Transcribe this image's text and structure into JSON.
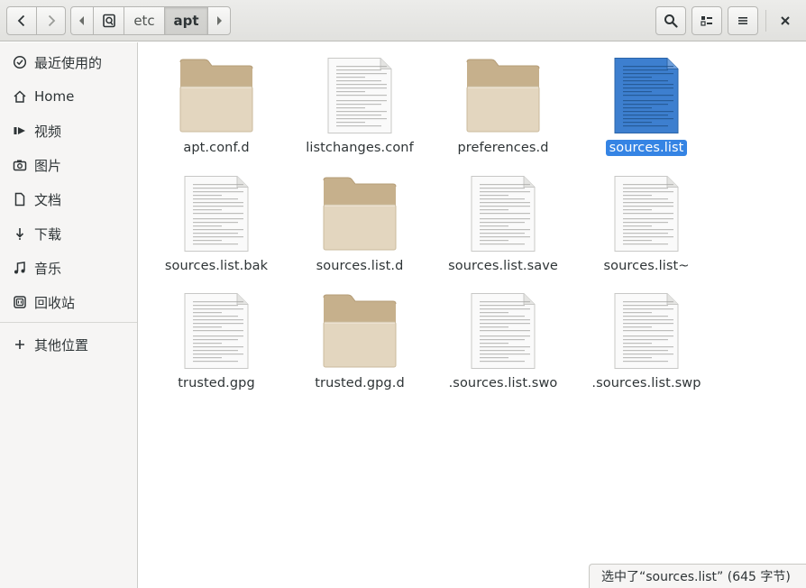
{
  "header": {
    "back_icon": "go-previous-icon",
    "forward_icon": "go-next-icon",
    "breadcrumb": {
      "scroll_left_icon": "pan-start-icon",
      "root_icon": "drive-harddisk-icon",
      "segments": [
        "etc",
        "apt"
      ],
      "current": "apt",
      "scroll_right_icon": "pan-end-icon"
    },
    "search_icon": "search-icon",
    "view_icon": "view-list-icon",
    "menu_icon": "hamburger-menu-icon",
    "close_icon": "close-icon"
  },
  "sidebar": {
    "items": [
      {
        "label": "最近使用的",
        "icon": "clock-icon"
      },
      {
        "label": "Home",
        "icon": "home-icon"
      },
      {
        "label": "视频",
        "icon": "video-icon"
      },
      {
        "label": "图片",
        "icon": "camera-icon"
      },
      {
        "label": "文档",
        "icon": "document-icon"
      },
      {
        "label": "下载",
        "icon": "download-icon"
      },
      {
        "label": "音乐",
        "icon": "music-icon"
      },
      {
        "label": "回收站",
        "icon": "trash-icon"
      }
    ],
    "other_locations": {
      "label": "其他位置",
      "icon": "plus-icon"
    }
  },
  "files": [
    {
      "name": "apt.conf.d",
      "type": "folder",
      "selected": false
    },
    {
      "name": "listchanges.conf",
      "type": "text",
      "selected": false
    },
    {
      "name": "preferences.d",
      "type": "folder",
      "selected": false
    },
    {
      "name": "sources.list",
      "type": "text",
      "selected": true
    },
    {
      "name": "sources.list.bak",
      "type": "text",
      "selected": false
    },
    {
      "name": "sources.list.d",
      "type": "folder",
      "selected": false
    },
    {
      "name": "sources.list.save",
      "type": "text",
      "selected": false
    },
    {
      "name": "sources.list~",
      "type": "text",
      "selected": false
    },
    {
      "name": "trusted.gpg",
      "type": "text",
      "selected": false
    },
    {
      "name": "trusted.gpg.d",
      "type": "folder",
      "selected": false
    },
    {
      "name": ".sources.list.swo",
      "type": "text",
      "selected": false
    },
    {
      "name": ".sources.list.swp",
      "type": "text",
      "selected": false
    }
  ],
  "status": {
    "text": "选中了“sources.list” (645 字节)"
  },
  "colors": {
    "selection": "#3584e4",
    "folder": "#e3d6bf",
    "folder_tab": "#c6b08c"
  }
}
